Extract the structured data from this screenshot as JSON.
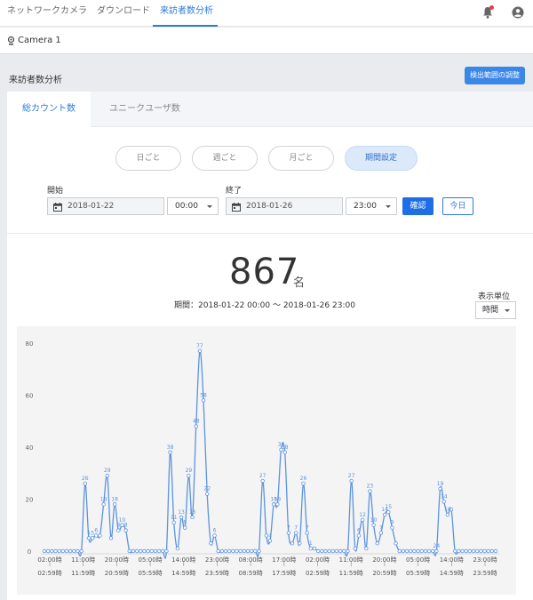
{
  "nav": {
    "tabs": [
      {
        "label": "ネットワークカメラ"
      },
      {
        "label": "ダウンロード"
      },
      {
        "label": "来訪者数分析"
      }
    ]
  },
  "camera": {
    "name": "Camera 1"
  },
  "section": {
    "title": "来訪者数分析",
    "adjust_button": "検出範囲の調整"
  },
  "tabs": [
    {
      "label": "総カウント数"
    },
    {
      "label": "ユニークユーザ数"
    }
  ],
  "periods": [
    {
      "label": "日ごと"
    },
    {
      "label": "週ごと"
    },
    {
      "label": "月ごと"
    },
    {
      "label": "期間設定"
    }
  ],
  "form": {
    "start_label": "開始",
    "start_date": "2018-01-22",
    "start_time": "00:00",
    "end_label": "終了",
    "end_date": "2018-01-26",
    "end_time": "23:00",
    "confirm_button": "確認",
    "today_button": "今日"
  },
  "summary": {
    "count": "867",
    "unit": "名",
    "period_text": "期間：2018-01-22 00:00 ～ 2018-01-26 23:00"
  },
  "display_unit": {
    "label": "表示単位",
    "value": "時間"
  },
  "colors": {
    "line": "#5b93e0",
    "accent": "#2f7ad8",
    "marker_fill": "#ffffff"
  },
  "chart_data": {
    "type": "line",
    "ylim": [
      0,
      80
    ],
    "yticks": [
      0,
      20,
      40,
      60,
      80
    ],
    "grid": false,
    "x_tick_labels": [
      [
        "02:00時",
        "02:59時"
      ],
      [
        "11:00時",
        "11:59時"
      ],
      [
        "20:00時",
        "20:59時"
      ],
      [
        "05:00時",
        "05:59時"
      ],
      [
        "14:00時",
        "14:59時"
      ],
      [
        "23:00時",
        "23:59時"
      ],
      [
        "08:00時",
        "08:59時"
      ],
      [
        "17:00時",
        "17:59時"
      ],
      [
        "02:00時",
        "02:59時"
      ],
      [
        "11:00時",
        "11:59時"
      ],
      [
        "20:00時",
        "20:59時"
      ],
      [
        "05:00時",
        "05:59時"
      ],
      [
        "14:00時",
        "14:59時"
      ],
      [
        "23:00時",
        "23:59時"
      ]
    ],
    "series": [
      {
        "values": [
          0,
          0,
          0,
          0,
          0,
          0,
          0,
          0,
          0,
          0,
          0,
          26,
          5,
          5,
          6,
          6,
          18,
          29,
          5,
          18,
          8,
          10,
          8,
          0,
          0,
          0,
          0,
          0,
          0,
          0,
          0,
          0,
          0,
          0,
          38,
          11,
          1,
          13,
          9,
          29,
          13,
          48,
          77,
          58,
          22,
          3,
          6,
          0,
          0,
          0,
          0,
          0,
          0,
          0,
          0,
          0,
          0,
          0,
          0,
          27,
          6,
          4,
          18,
          18,
          39,
          38,
          7,
          3,
          7,
          3,
          26,
          7,
          1,
          1,
          0,
          0,
          0,
          0,
          0,
          0,
          0,
          0,
          0,
          27,
          1,
          6,
          12,
          1,
          23,
          10,
          3,
          7,
          14,
          15,
          9,
          3,
          0,
          0,
          0,
          0,
          0,
          0,
          0,
          0,
          0,
          0,
          0,
          24,
          19,
          14,
          16,
          0,
          0,
          0,
          0,
          0,
          0,
          0,
          0,
          0,
          0,
          0,
          0
        ]
      }
    ],
    "data_labels": [
      {
        "index": 11,
        "text": "26"
      },
      {
        "index": 12,
        "text": "5"
      },
      {
        "index": 13,
        "text": "5"
      },
      {
        "index": 14,
        "text": "6"
      },
      {
        "index": 16,
        "text": "18"
      },
      {
        "index": 17,
        "text": "29"
      },
      {
        "index": 19,
        "text": "18"
      },
      {
        "index": 20,
        "text": "8"
      },
      {
        "index": 21,
        "text": "10"
      },
      {
        "index": 22,
        "text": "8"
      },
      {
        "index": 34,
        "text": "38"
      },
      {
        "index": 35,
        "text": "11"
      },
      {
        "index": 37,
        "text": "13"
      },
      {
        "index": 38,
        "text": "9"
      },
      {
        "index": 39,
        "text": "29"
      },
      {
        "index": 40,
        "text": "13"
      },
      {
        "index": 41,
        "text": "48"
      },
      {
        "index": 42,
        "text": "77"
      },
      {
        "index": 43,
        "text": "58"
      },
      {
        "index": 44,
        "text": "22"
      },
      {
        "index": 46,
        "text": "6"
      },
      {
        "index": 59,
        "text": "27"
      },
      {
        "index": 61,
        "text": "4"
      },
      {
        "index": 62,
        "text": "18"
      },
      {
        "index": 63,
        "text": "18"
      },
      {
        "index": 64,
        "text": "39"
      },
      {
        "index": 65,
        "text": "38"
      },
      {
        "index": 66,
        "text": "7"
      },
      {
        "index": 68,
        "text": "7"
      },
      {
        "index": 70,
        "text": "26"
      },
      {
        "index": 71,
        "text": "7"
      },
      {
        "index": 72,
        "text": "1"
      },
      {
        "index": 83,
        "text": "27"
      },
      {
        "index": 85,
        "text": "6"
      },
      {
        "index": 86,
        "text": "12"
      },
      {
        "index": 88,
        "text": "23"
      },
      {
        "index": 89,
        "text": "10"
      },
      {
        "index": 91,
        "text": "7"
      },
      {
        "index": 92,
        "text": "14"
      },
      {
        "index": 93,
        "text": "15"
      },
      {
        "index": 94,
        "text": "9"
      },
      {
        "index": 106,
        "text": "24"
      },
      {
        "index": 107,
        "text": "19"
      },
      {
        "index": 108,
        "text": "14"
      },
      {
        "index": 109,
        "text": "16"
      }
    ]
  }
}
